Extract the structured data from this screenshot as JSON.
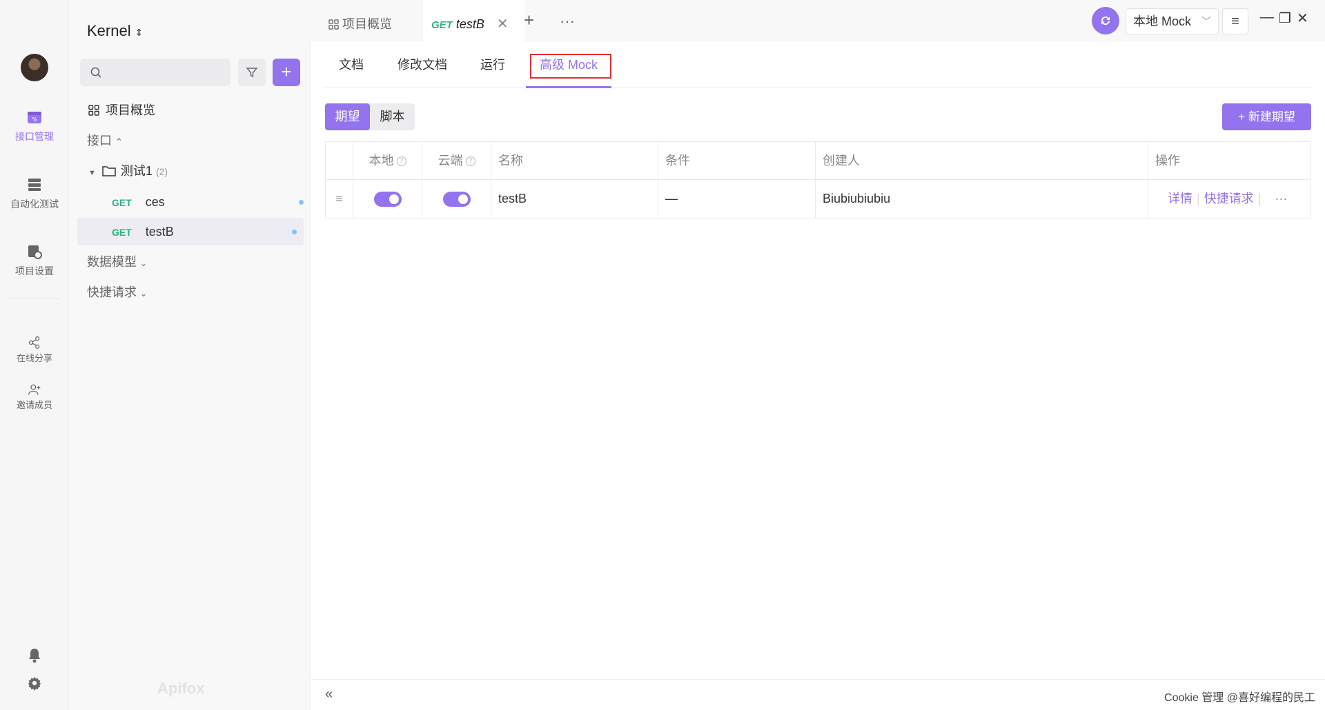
{
  "rail": {
    "items": [
      {
        "label": "接口管理",
        "icon": "api-management-icon"
      },
      {
        "label": "自动化测试",
        "icon": "automation-test-icon"
      },
      {
        "label": "项目设置",
        "icon": "project-settings-icon"
      },
      {
        "label": "在线分享",
        "icon": "share-icon"
      },
      {
        "label": "邀请成员",
        "icon": "invite-member-icon"
      }
    ]
  },
  "sidebar": {
    "project_name": "Kernel",
    "overview": "项目概览",
    "api_section": "接口",
    "folder": {
      "name": "测试1",
      "count": "(2)"
    },
    "apis": [
      {
        "method": "GET",
        "name": "ces"
      },
      {
        "method": "GET",
        "name": "testB"
      }
    ],
    "data_models": "数据模型",
    "quick_requests": "快捷请求",
    "brand": "Apifox"
  },
  "tabbar": {
    "overview_tab": "项目概览",
    "active_tab_method": "GET",
    "active_tab_name": "testB",
    "environment": "本地 Mock"
  },
  "subtabs": [
    "文档",
    "修改文档",
    "运行",
    "高级 Mock"
  ],
  "segment": {
    "expect": "期望",
    "script": "脚本"
  },
  "new_expect_button": "新建期望",
  "table": {
    "headers": {
      "local": "本地",
      "cloud": "云端",
      "name": "名称",
      "condition": "条件",
      "creator": "创建人",
      "actions": "操作"
    },
    "rows": [
      {
        "local": true,
        "cloud": true,
        "name": "testB",
        "condition": "—",
        "creator": "Biubiubiubiu",
        "detail": "详情",
        "quick": "快捷请求",
        "more": "···"
      }
    ]
  },
  "bottombar": {
    "status": "Cookie 管理  @喜好编程的民工"
  },
  "colors": {
    "accent": "#9373ee",
    "get": "#2cb37c",
    "highlight_box": "#e52d2d"
  }
}
